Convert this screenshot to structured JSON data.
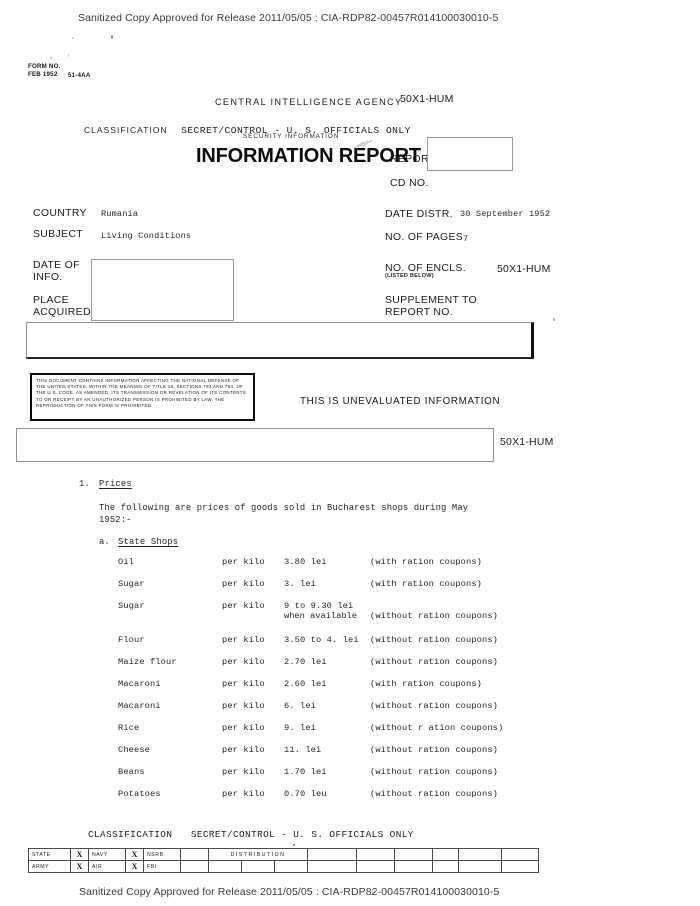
{
  "release": {
    "top_banner": "Sanitized Copy Approved for Release 2011/05/05 : CIA-RDP82-00457R014100030010-5",
    "bottom_banner": "Sanitized Copy Approved for Release 2011/05/05 : CIA-RDP82-00457R014100030010-5"
  },
  "form_stamp": {
    "line1": "FORM NO.",
    "line2": "FEB 1952",
    "code": "51-4AA"
  },
  "header": {
    "agency": "CENTRAL  INTELLIGENCE  AGENCY",
    "classification_label": "CLASSIFICATION",
    "classification_value": "SECRET/CONTROL - U. S. OFFICIALS ONLY",
    "security_information": "SECURITY INFORMATION",
    "title": "INFORMATION REPORT",
    "report_label": "REPORT",
    "cd_no_label": "CD NO.",
    "declass_marking_top": "50X1-HUM"
  },
  "form_fields": {
    "country_label": "COUNTRY",
    "country_value": "Rumania",
    "subject_label": "SUBJECT",
    "subject_value": "Living Conditions",
    "date_of_info_label_line1": "DATE OF",
    "date_of_info_label_line2": "INFO.",
    "place_acquired_label_line1": "PLACE",
    "place_acquired_label_line2": "ACQUIRED",
    "date_distr_label": "DATE DISTR.",
    "date_distr_value": "30 September 1952",
    "no_of_pages_label": "NO. OF PAGES",
    "no_of_pages_value": "7",
    "no_of_encls_label": "NO. OF ENCLS.",
    "no_of_encls_sublabel": "(LISTED BELOW)",
    "encls_declass_marking": "50X1-HUM",
    "supplement_label_line1": "SUPPLEMENT TO",
    "supplement_label_line2": "REPORT NO.",
    "redaction_declass_marking": "50X1-HUM"
  },
  "warning": {
    "text": "THIS DOCUMENT CONTAINS INFORMATION AFFECTING THE NATIONAL DEFENSE OF THE UNITED STATES, WITHIN THE MEANING OF TITLE 18, SECTIONS 793 AND 794, OF THE U.S. CODE, AS AMENDED.  ITS TRANSMISSION OR REVELATION OF ITS CONTENTS TO OR RECEIPT BY AN UNAUTHORIZED PERSON IS PROHIBITED BY LAW.   THE REPRODUCTION OF THIS FORM IS PROHIBITED.",
    "unevaluated_notice": "THIS IS UNEVALUATED INFORMATION"
  },
  "body": {
    "section_number": "1.",
    "section_title": "Prices",
    "intro_line1": "The following are prices of goods sold in Bucharest shops during May",
    "intro_line2": "1952:-",
    "subsection_letter": "a.",
    "subsection_title": "State Shops",
    "price_rows": [
      {
        "item": "Oil",
        "unit": "per kilo",
        "price": "3.80 lei",
        "price_sub": "",
        "note": "(with ration coupons)"
      },
      {
        "item": "Sugar",
        "unit": "per kilo",
        "price": "3. lei",
        "price_sub": "",
        "note": "(with ration coupons)"
      },
      {
        "item": "Sugar",
        "unit": "per kilo",
        "price": "9 to 9.30 lei",
        "price_sub": "when available",
        "note": "(without ration coupons)"
      },
      {
        "item": "Flour",
        "unit": "per kilo",
        "price": "3.50 to 4. lei",
        "price_sub": "",
        "note": "(without ration coupons)"
      },
      {
        "item": "Maize flour",
        "unit": "per kilo",
        "price": "2.70 lei",
        "price_sub": "",
        "note": "(without ration coupons)"
      },
      {
        "item": "Macaroni",
        "unit": "per kilo",
        "price": "2.60 lei",
        "price_sub": "",
        "note": "(with ration coupons)"
      },
      {
        "item": "Macaroni",
        "unit": "per kilo",
        "price": "6. lei",
        "price_sub": "",
        "note": "(without ration coupons)"
      },
      {
        "item": "Rice",
        "unit": "per kilo",
        "price": "9. lei",
        "price_sub": "",
        "note": "(without r ation coupons)"
      },
      {
        "item": "Cheese",
        "unit": "per kilo",
        "price": "11. lei",
        "price_sub": "",
        "note": "(without ration coupons)"
      },
      {
        "item": "Beans",
        "unit": "per kilo",
        "price": "1.70 lei",
        "price_sub": "",
        "note": "(without ration coupons)"
      },
      {
        "item": "Potatoes",
        "unit": "per kilo",
        "price": "0.70 leu",
        "price_sub": "",
        "note": "(without ration coupons)"
      }
    ]
  },
  "footer": {
    "classification_label": "CLASSIFICATION",
    "classification_value": "SECRET/CONTROL - U. S. OFFICIALS ONLY"
  },
  "distribution": {
    "header_label": "DISTRIBUTION",
    "row1": {
      "agency1": "STATE",
      "mark1": "X",
      "agency2": "NAVY",
      "mark2": "X",
      "agency3": "NSRB"
    },
    "row2": {
      "agency1": "ARMY",
      "mark1": "X",
      "agency2": "AIR",
      "mark2": "X",
      "agency3": "FBI"
    }
  }
}
